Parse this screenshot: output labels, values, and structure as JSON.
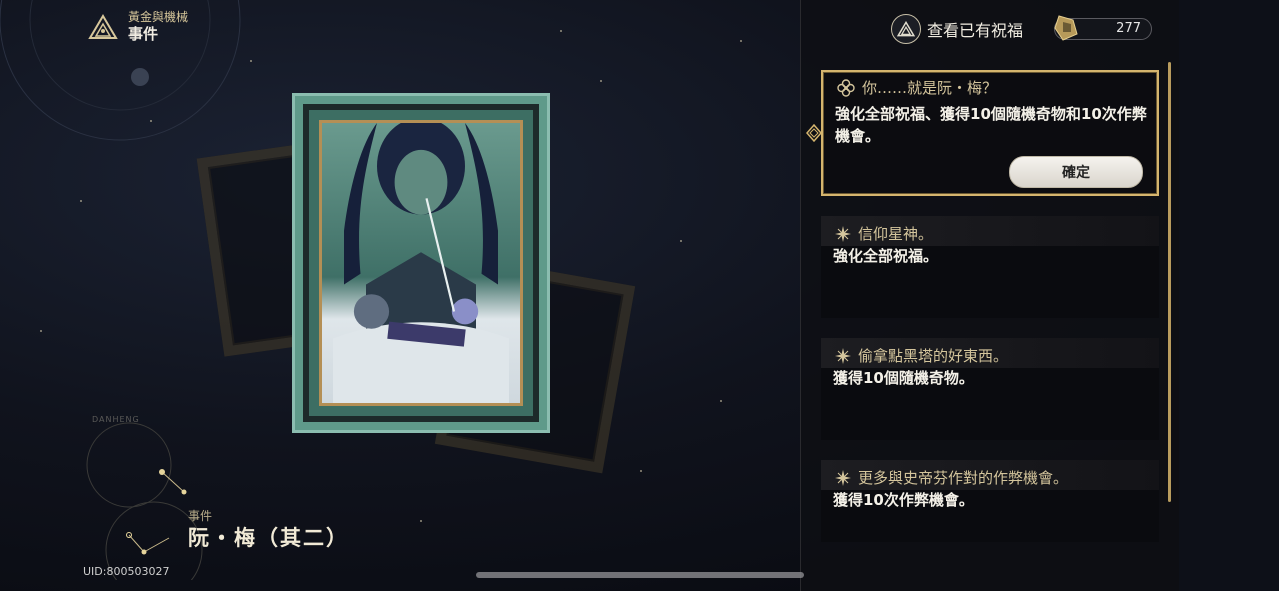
{
  "header": {
    "world": "黃金與機械",
    "type": "事件",
    "world_icon": "triangle-emblem-icon"
  },
  "event": {
    "label": "事件",
    "name": "阮・梅（其二）",
    "constellation_label": "DANHENG"
  },
  "uid": "UID:800503027",
  "top_bar": {
    "blessing_label": "查看已有祝福",
    "blessing_icon": "triangle-emblem-icon",
    "currency_value": "277",
    "currency_icon": "cosmic-fragment-icon"
  },
  "options": [
    {
      "title": "你……就是阮・梅？",
      "desc": "強化全部祝福、獲得10個隨機奇物和10次作弊機會。",
      "icon": "flower-icon",
      "confirm_label": "確定",
      "selected": true
    },
    {
      "title": "信仰星神。",
      "desc": "強化全部祝福。",
      "icon": "star-icon"
    },
    {
      "title": "偷拿點黑塔的好東西。",
      "desc": "獲得10個隨機奇物。",
      "icon": "star-icon"
    },
    {
      "title": "更多與史帝芬作對的作弊機會。",
      "desc": "獲得10次作弊機會。",
      "icon": "star-icon"
    }
  ],
  "colors": {
    "accent_gold": "#d5b56e",
    "frame_teal": "#5f9a8a",
    "background": "#0b0d16"
  }
}
